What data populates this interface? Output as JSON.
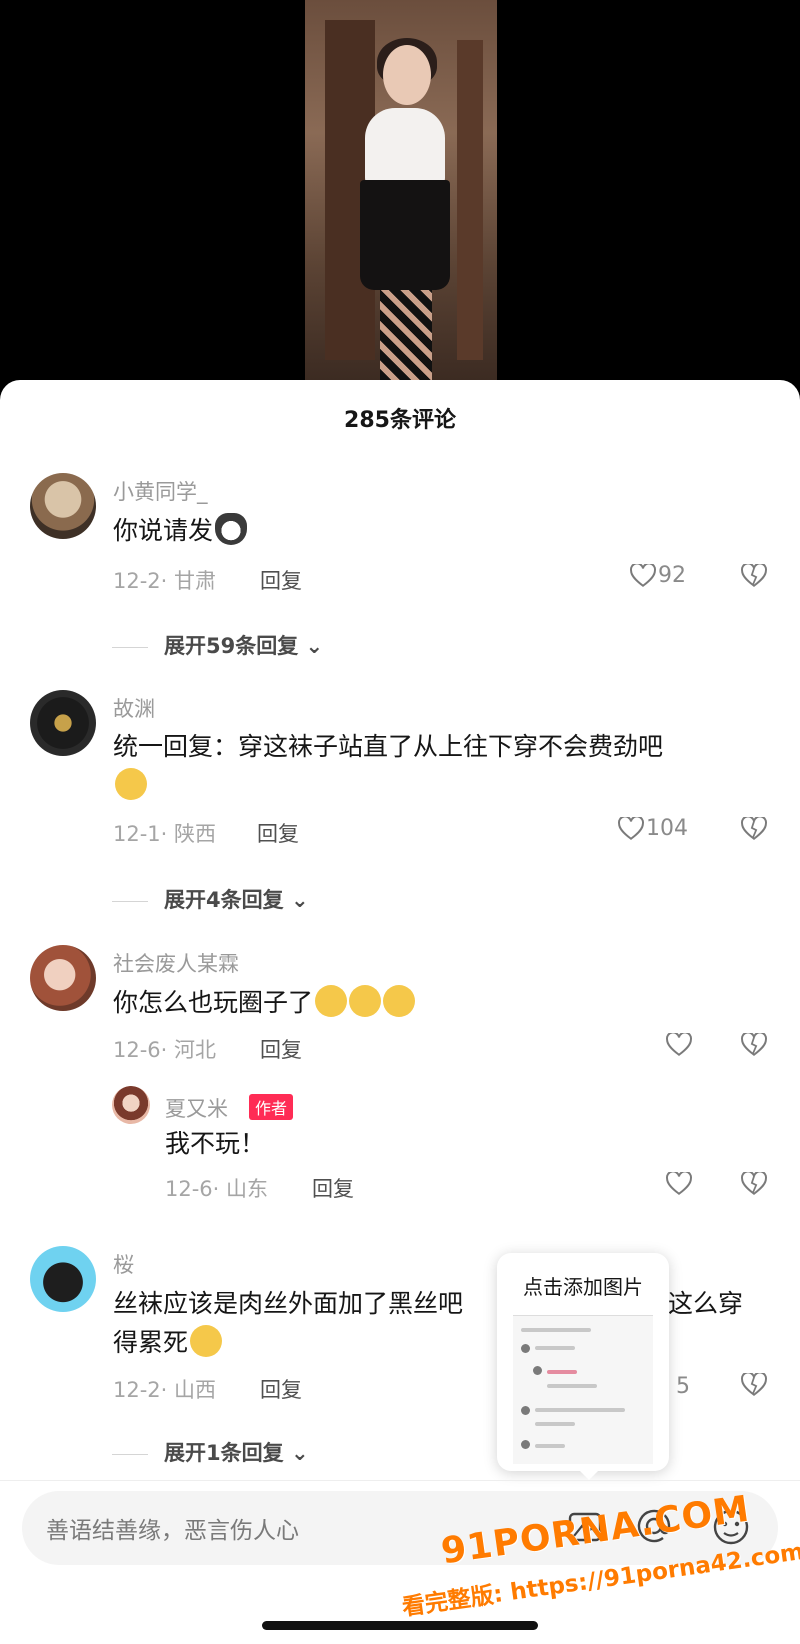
{
  "sheet": {
    "title": "285条评论"
  },
  "comments": [
    {
      "name": "小黄同学_",
      "text": "你说请发",
      "date": "12-2",
      "location": "甘肃",
      "reply": "回复",
      "likes": "92",
      "expand": "展开59条回复"
    },
    {
      "name": "故渊",
      "text": "统一回复：穿这袜子站直了从上往下穿不会费劲吧",
      "date": "12-1",
      "location": "陕西",
      "reply": "回复",
      "likes": "104",
      "expand": "展开4条回复"
    },
    {
      "name": "社会废人某霖",
      "text": "你怎么也玩圈子了",
      "date": "12-6",
      "location": "河北",
      "reply": "回复",
      "likes": ""
    },
    {
      "name": "夏又米",
      "tag": "作者",
      "text": "我不玩！",
      "date": "12-6",
      "location": "山东",
      "reply": "回复",
      "likes": ""
    },
    {
      "name": "桜",
      "text_line1_a": "丝袜应该是肉丝外面加了黑丝吧",
      "text_line1_b": "这么穿",
      "text_line2": "得累死",
      "date": "12-2",
      "location": "山西",
      "reply": "回复",
      "likes_partial": "5",
      "expand": "展开1条回复"
    }
  ],
  "popup": {
    "title": "点击添加图片"
  },
  "input": {
    "placeholder": "善语结善缘，恶言伤人心"
  },
  "watermark": {
    "line1": "91PORNA.COM",
    "line2": "看完整版: https://91porna42.com"
  },
  "icons": [
    "heart-icon",
    "broken-heart-icon",
    "image-icon",
    "at-icon",
    "emoji-icon"
  ],
  "colors": {
    "author_tag": "#ff2c55",
    "watermark": "#ff7b00"
  }
}
